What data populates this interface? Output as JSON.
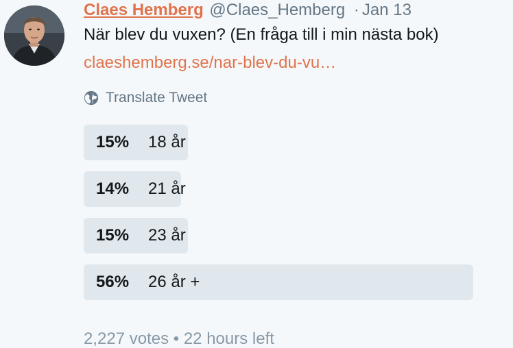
{
  "author": {
    "name": "Claes Hemberg",
    "handle": "@Claes_Hemberg",
    "separator": "·",
    "date": "Jan 13"
  },
  "tweet": {
    "text": "När blev du vuxen? (En fråga till i min nästa bok)",
    "link": "claeshemberg.se/nar-blev-du-vu…",
    "translate_label": "Translate Tweet",
    "translate_icon": "globe-icon"
  },
  "poll": {
    "choices": [
      {
        "percent_label": "15%",
        "label": "18 år",
        "percent": 15
      },
      {
        "percent_label": "14%",
        "label": "21 år",
        "percent": 14
      },
      {
        "percent_label": "15%",
        "label": "23 år",
        "percent": 15
      },
      {
        "percent_label": "56%",
        "label": "26 år +",
        "percent": 56
      }
    ],
    "footer": "2,227 votes • 22 hours left"
  },
  "colors": {
    "accent": "#e0734c",
    "muted": "#657786",
    "bar": "#e1e8ed",
    "background": "#f5f8fa"
  }
}
